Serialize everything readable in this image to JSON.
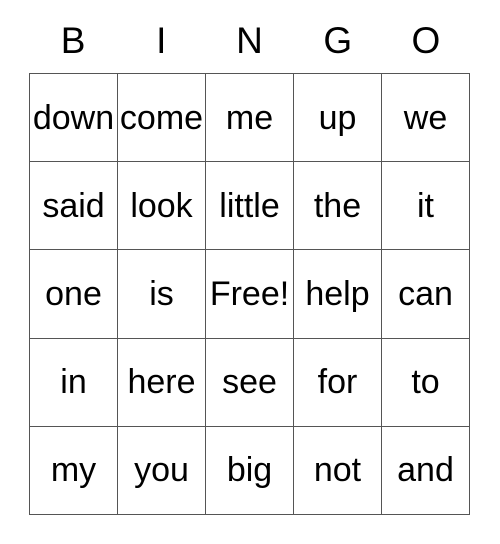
{
  "card": {
    "header_letters": [
      "B",
      "I",
      "N",
      "G",
      "O"
    ],
    "rows": [
      {
        "cells": [
          "down",
          "come",
          "me",
          "up",
          "we"
        ]
      },
      {
        "cells": [
          "said",
          "look",
          "little",
          "the",
          "it"
        ]
      },
      {
        "cells": [
          "one",
          "is",
          "Free!",
          "help",
          "can"
        ]
      },
      {
        "cells": [
          "in",
          "here",
          "see",
          "for",
          "to"
        ]
      },
      {
        "cells": [
          "my",
          "you",
          "big",
          "not",
          "and"
        ]
      }
    ],
    "free_space_label": "Free!",
    "colors": {
      "background": "#ffffff",
      "text": "#000000",
      "border": "#555555"
    }
  }
}
